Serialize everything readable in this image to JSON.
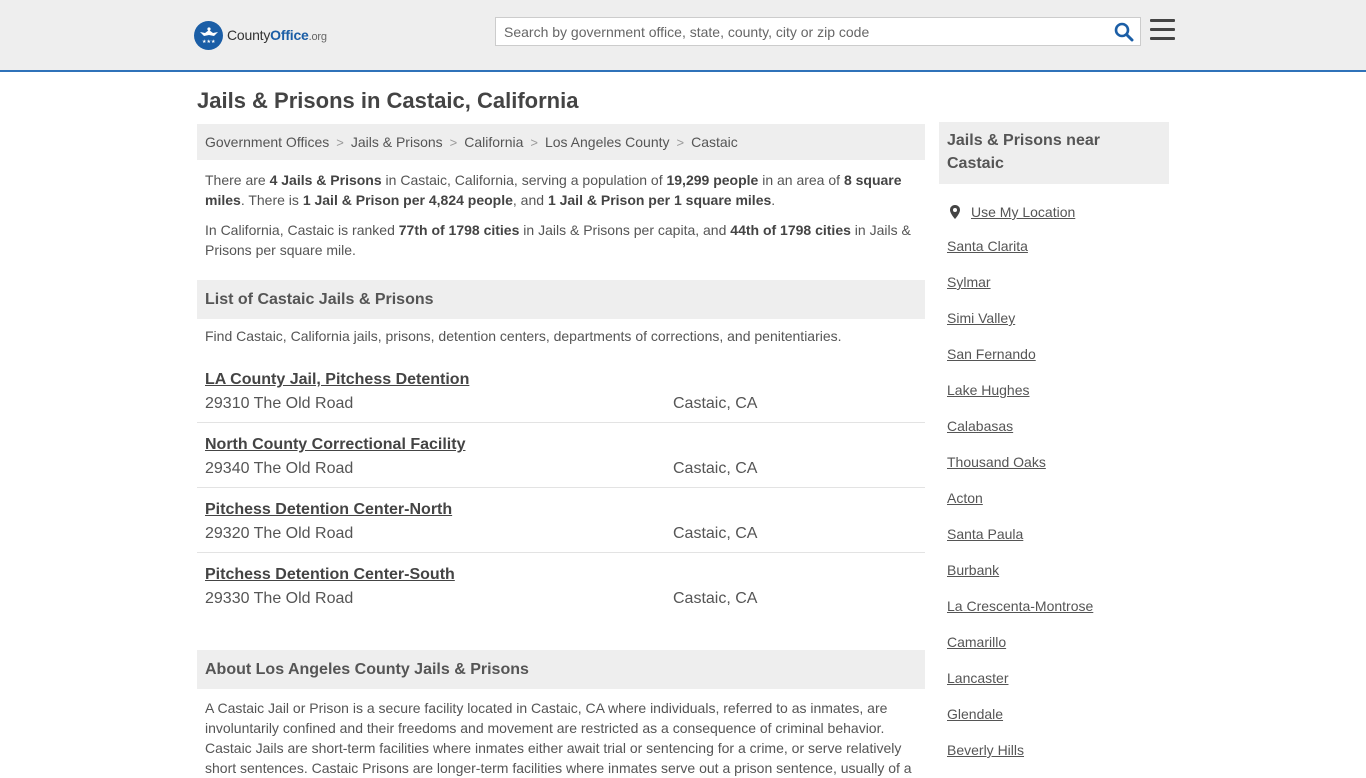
{
  "header": {
    "logo_text_1": "County",
    "logo_text_2": "Office",
    "logo_text_3": ".org",
    "search_placeholder": "Search by government office, state, county, city or zip code"
  },
  "page_title": "Jails & Prisons in Castaic, California",
  "breadcrumb": [
    "Government Offices",
    "Jails & Prisons",
    "California",
    "Los Angeles County",
    "Castaic"
  ],
  "intro": {
    "p1": [
      {
        "t": "There are ",
        "b": false
      },
      {
        "t": "4 Jails & Prisons",
        "b": true
      },
      {
        "t": " in Castaic, California, serving a population of ",
        "b": false
      },
      {
        "t": "19,299 people",
        "b": true
      },
      {
        "t": " in an area of ",
        "b": false
      },
      {
        "t": "8 square miles",
        "b": true
      },
      {
        "t": ". There is ",
        "b": false
      },
      {
        "t": "1 Jail & Prison per 4,824 people",
        "b": true
      },
      {
        "t": ", and ",
        "b": false
      },
      {
        "t": "1 Jail & Prison per 1 square miles",
        "b": true
      },
      {
        "t": ".",
        "b": false
      }
    ],
    "p2": [
      {
        "t": "In California, Castaic is ranked ",
        "b": false
      },
      {
        "t": "77th of 1798 cities",
        "b": true
      },
      {
        "t": " in Jails & Prisons per capita, and ",
        "b": false
      },
      {
        "t": "44th of 1798 cities",
        "b": true
      },
      {
        "t": " in Jails & Prisons per square mile.",
        "b": false
      }
    ]
  },
  "list_section": {
    "heading": "List of Castaic Jails & Prisons",
    "description": "Find Castaic, California jails, prisons, detention centers, departments of corrections, and penitentiaries.",
    "facilities": [
      {
        "name": "LA County Jail, Pitchess Detention",
        "address": "29310 The Old Road",
        "city": "Castaic, CA"
      },
      {
        "name": "North County Correctional Facility",
        "address": "29340 The Old Road",
        "city": "Castaic, CA"
      },
      {
        "name": "Pitchess Detention Center-North",
        "address": "29320 The Old Road",
        "city": "Castaic, CA"
      },
      {
        "name": "Pitchess Detention Center-South",
        "address": "29330 The Old Road",
        "city": "Castaic, CA"
      }
    ]
  },
  "about_section": {
    "heading": "About Los Angeles County Jails & Prisons",
    "text": "A Castaic Jail or Prison is a secure facility located in Castaic, CA where individuals, referred to as inmates, are involuntarily confined and their freedoms and movement are restricted as a consequence of criminal behavior. Castaic Jails are short-term facilities where inmates either await trial or sentencing for a crime, or serve relatively short sentences. Castaic Prisons are longer-term facilities where inmates serve out a prison sentence, usually of a"
  },
  "sidebar": {
    "heading": "Jails & Prisons near Castaic",
    "use_location": "Use My Location",
    "cities": [
      "Santa Clarita",
      "Sylmar",
      "Simi Valley",
      "San Fernando",
      "Lake Hughes",
      "Calabasas",
      "Thousand Oaks",
      "Acton",
      "Santa Paula",
      "Burbank",
      "La Crescenta-Montrose",
      "Camarillo",
      "Lancaster",
      "Glendale",
      "Beverly Hills"
    ]
  },
  "colors": {
    "brand_blue": "#1b5ea6",
    "header_border": "#2f72b9",
    "panel_bg": "#eeeeee"
  }
}
